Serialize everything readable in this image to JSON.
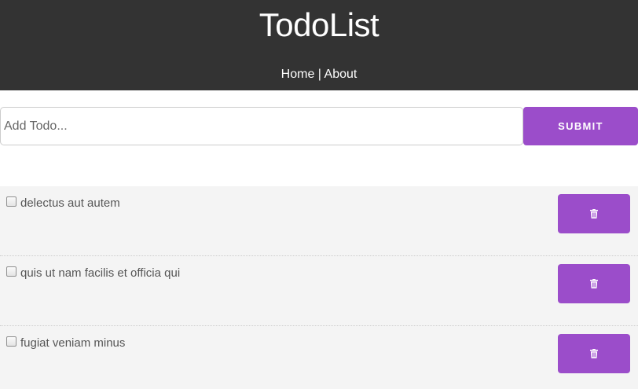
{
  "header": {
    "title": "TodoList",
    "nav": {
      "home_label": "Home",
      "separator": " | ",
      "about_label": "About"
    }
  },
  "add_todo": {
    "placeholder": "Add Todo...",
    "value": "",
    "submit_label": "SUBMIT"
  },
  "todos": [
    {
      "title": "delectus aut autem",
      "completed": false,
      "delete_icon": "trash-icon"
    },
    {
      "title": "quis ut nam facilis et officia qui",
      "completed": false,
      "delete_icon": "trash-icon"
    },
    {
      "title": "fugiat veniam minus",
      "completed": false,
      "delete_icon": "trash-icon"
    }
  ],
  "colors": {
    "header_bg": "#333333",
    "accent": "#9b4dca",
    "todo_bg": "#f4f4f4",
    "text": "#555555"
  }
}
